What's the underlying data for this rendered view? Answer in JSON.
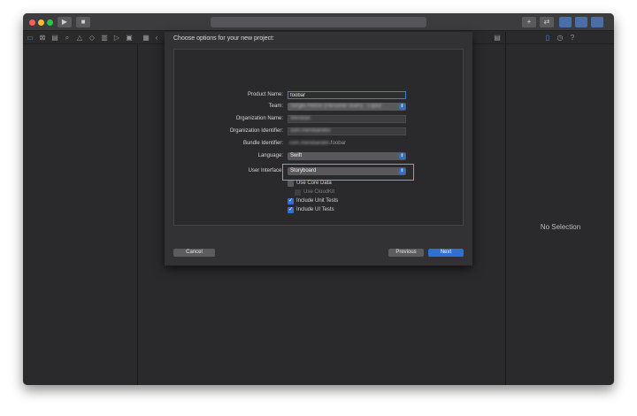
{
  "window": {
    "traffic_colors": [
      "#ff5f57",
      "#febc2e",
      "#28c840"
    ],
    "run_icon": "play-icon",
    "stop_icon": "stop-icon"
  },
  "navigator_icons": [
    "folder-icon",
    "source-control-icon",
    "symbol-icon",
    "find-icon",
    "issue-icon",
    "test-icon",
    "debug-icon",
    "breakpoint-icon",
    "report-icon"
  ],
  "sheet": {
    "title": "Choose options for your new project:",
    "fields": {
      "product_name_label": "Product Name:",
      "product_name_value": "foobar",
      "team_label": "Team:",
      "team_value": "Sergei Petrov (Personal Team) - Lopez",
      "org_name_label": "Organization Name:",
      "org_name_value": "Meridian",
      "org_id_label": "Organization Identifier:",
      "org_id_value": "com.meridiandev",
      "bundle_id_label": "Bundle Identifier:",
      "bundle_id_prefix": "com.meridiandev",
      "bundle_id_suffix": ".foobar",
      "language_label": "Language:",
      "language_value": "Swift",
      "ui_label": "User Interface:",
      "ui_value": "Storyboard"
    },
    "options": {
      "core_data": "Use Core Data",
      "cloudkit": "Use CloudKit",
      "unit_tests": "Include Unit Tests",
      "ui_tests": "Include UI Tests"
    },
    "buttons": {
      "cancel": "Cancel",
      "previous": "Previous",
      "next": "Next"
    },
    "highlight_color": "#39e13a",
    "accent_color": "#2f6fd6"
  },
  "inspector": {
    "empty_text": "No Selection"
  }
}
